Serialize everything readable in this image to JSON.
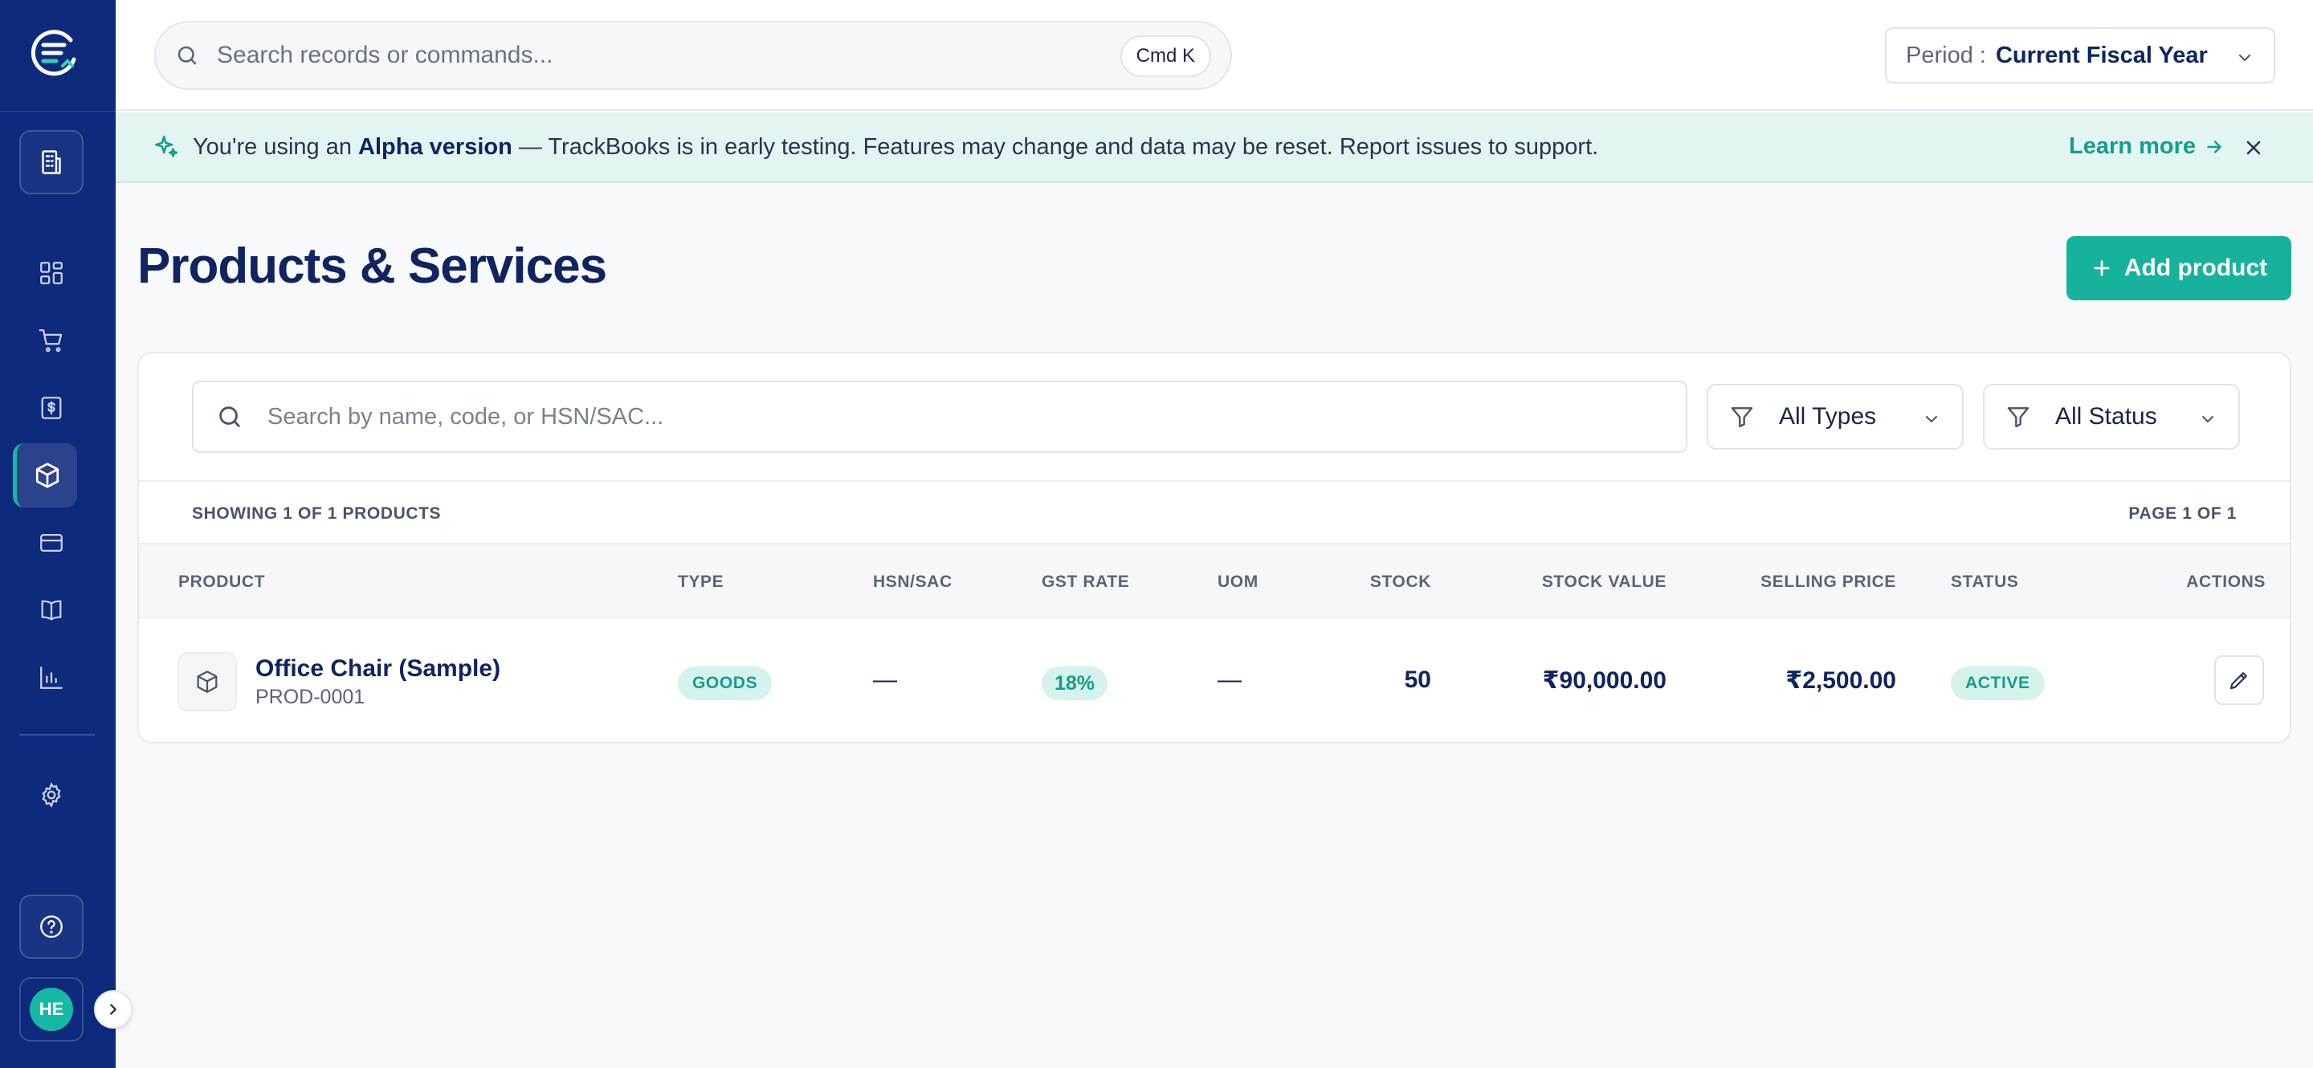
{
  "app": {
    "name": "TrackBooks"
  },
  "topbar": {
    "search_placeholder": "Search records or commands...",
    "shortcut": "Cmd K",
    "period_label": "Period :",
    "period_value": "Current Fiscal Year"
  },
  "banner": {
    "prefix": "You're using an",
    "highlight": "Alpha version",
    "suffix": "— TrackBooks is in early testing. Features may change and data may be reset. Report issues to support.",
    "link": "Learn more"
  },
  "sidebar": {
    "items": [
      {
        "name": "company",
        "icon": "building-icon"
      },
      {
        "name": "dashboard",
        "icon": "grid-icon"
      },
      {
        "name": "sales",
        "icon": "cart-icon"
      },
      {
        "name": "invoices",
        "icon": "receipt-dollar-icon"
      },
      {
        "name": "products",
        "icon": "box-icon",
        "active": true
      },
      {
        "name": "payments",
        "icon": "credit-card-icon"
      },
      {
        "name": "ledger",
        "icon": "book-icon"
      },
      {
        "name": "reports",
        "icon": "bar-chart-icon"
      },
      {
        "name": "settings",
        "icon": "gear-icon"
      },
      {
        "name": "help",
        "icon": "help-circle-icon"
      }
    ],
    "avatar_initials": "HE"
  },
  "page": {
    "title": "Products & Services",
    "add_button": "Add product"
  },
  "filters": {
    "search_placeholder": "Search by name, code, or HSN/SAC...",
    "type": "All Types",
    "status": "All Status"
  },
  "meta": {
    "showing": "SHOWING 1 OF 1 PRODUCTS",
    "page": "PAGE 1 OF 1"
  },
  "table": {
    "headers": {
      "product": "PRODUCT",
      "type": "TYPE",
      "hsn": "HSN/SAC",
      "gst": "GST RATE",
      "uom": "UOM",
      "stock": "STOCK",
      "stock_value": "STOCK VALUE",
      "selling_price": "SELLING PRICE",
      "status": "STATUS",
      "actions": "ACTIONS"
    },
    "rows": [
      {
        "name": "Office Chair (Sample)",
        "code": "PROD-0001",
        "type": "GOODS",
        "hsn": "—",
        "gst": "18%",
        "uom": "—",
        "stock": "50",
        "stock_value": "₹90,000.00",
        "selling_price": "₹2,500.00",
        "status": "ACTIVE"
      }
    ]
  },
  "colors": {
    "sidebar": "#0d2a7d",
    "accent": "#17b29b",
    "title": "#0f2460",
    "banner_bg": "#e3f5f2"
  }
}
